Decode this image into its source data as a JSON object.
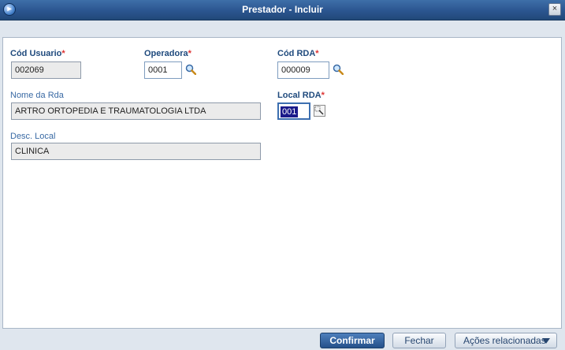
{
  "window": {
    "title": "Prestador - Incluir",
    "close_label": "×"
  },
  "form": {
    "cod_usuario": {
      "label": "Cód Usuario",
      "value": "002069"
    },
    "operadora": {
      "label": "Operadora",
      "value": "0001"
    },
    "cod_rda": {
      "label": "Cód RDA",
      "value": "000009"
    },
    "nome_rda": {
      "label": "Nome da Rda",
      "value": "ARTRO ORTOPEDIA E TRAUMATOLOGIA LTDA"
    },
    "local_rda": {
      "label": "Local RDA",
      "value": "001"
    },
    "desc_local": {
      "label": "Desc. Local",
      "value": "CLINICA"
    },
    "required_mark": "*"
  },
  "footer": {
    "confirm": "Confirmar",
    "close": "Fechar",
    "actions": "Ações relacionadas"
  },
  "colors": {
    "title_bar": "#2b5590",
    "required_star": "#dd3333",
    "primary_button": "#25508a"
  }
}
